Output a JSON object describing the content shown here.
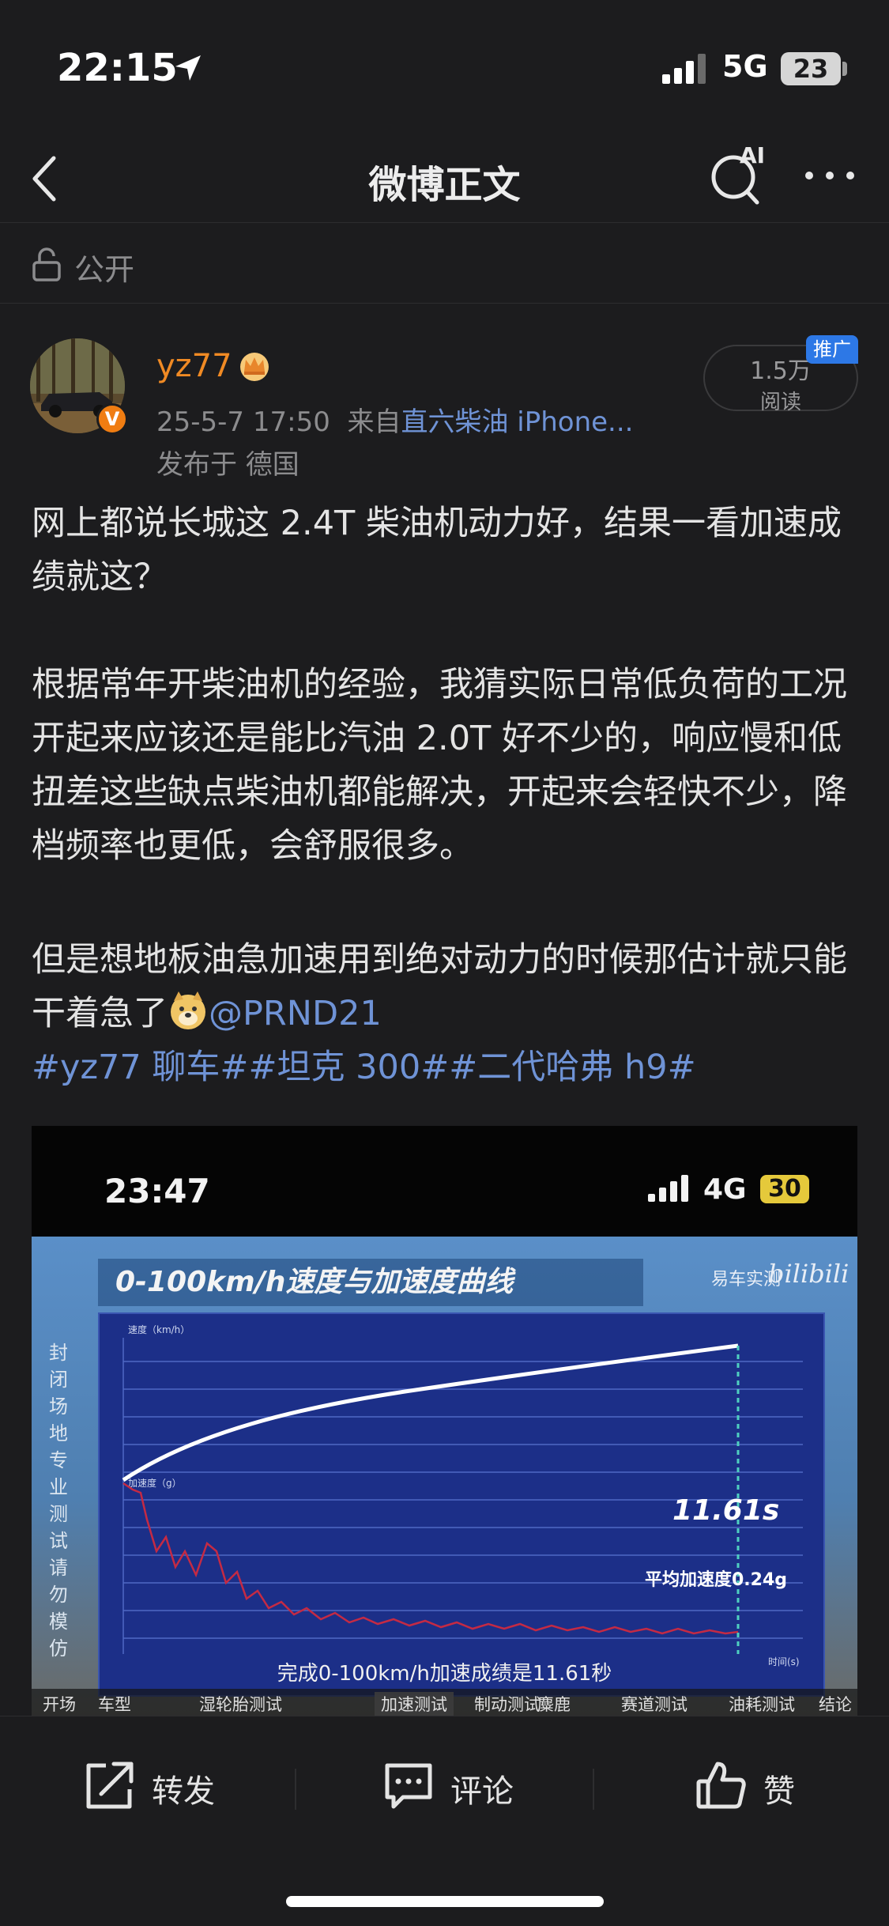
{
  "status_bar": {
    "time": "22:15",
    "network": "5G",
    "battery": "23"
  },
  "nav": {
    "title": "微博正文",
    "ai_label": "AI"
  },
  "visibility": {
    "label": "公开"
  },
  "post": {
    "author": {
      "name": "yz77",
      "badge": "V"
    },
    "meta_time": "25-5-7 17:50",
    "meta_from": "来自",
    "meta_source": "直六柴油 iPhone...",
    "location": "发布于 德国",
    "reads": {
      "count": "1.5万",
      "label": "阅读"
    },
    "promo_badge": "推广",
    "paragraph1": "网上都说长城这 2.4T 柴油机动力好，结果一看加速成绩就这？",
    "paragraph2": "根据常年开柴油机的经验，我猜实际日常低负荷的工况开起来应该还是能比汽油 2.0T 好不少的，响应慢和低扭差这些缺点柴油机都能解决，开起来会轻快不少，降档频率也更低，会舒服很多。",
    "paragraph3": "但是想地板油急加速用到绝对动力的时候那估计就只能干着急了",
    "mention": "@PRND21",
    "hashtags": "#yz77 聊车##坦克 300##二代哈弗 h9#"
  },
  "media": {
    "phone_time": "23:47",
    "phone_network": "4G",
    "phone_battery": "30",
    "video_title": "0-100km/h速度与加速度曲线",
    "video_source": "易车实测",
    "video_logo": "bilibili",
    "side_caption": "封闭场地 专业测试 请勿模仿",
    "chart_speed_label": "速度（km/h）",
    "chart_acc_label": "加速度（g）",
    "chart_time_label": "时间(s)",
    "result_time": "11.61s",
    "avg_acceleration": "平均加速度0.24g",
    "subtitle": "完成0-100km/h加速成绩是11.61秒",
    "chapters": [
      "开场",
      "车型",
      "湿轮胎测试",
      "加速测试",
      "制动测试",
      "麋鹿",
      "赛道测试",
      "油耗测试",
      "结论"
    ]
  },
  "actions": {
    "repost": "转发",
    "comment": "评论",
    "like": "赞"
  }
}
